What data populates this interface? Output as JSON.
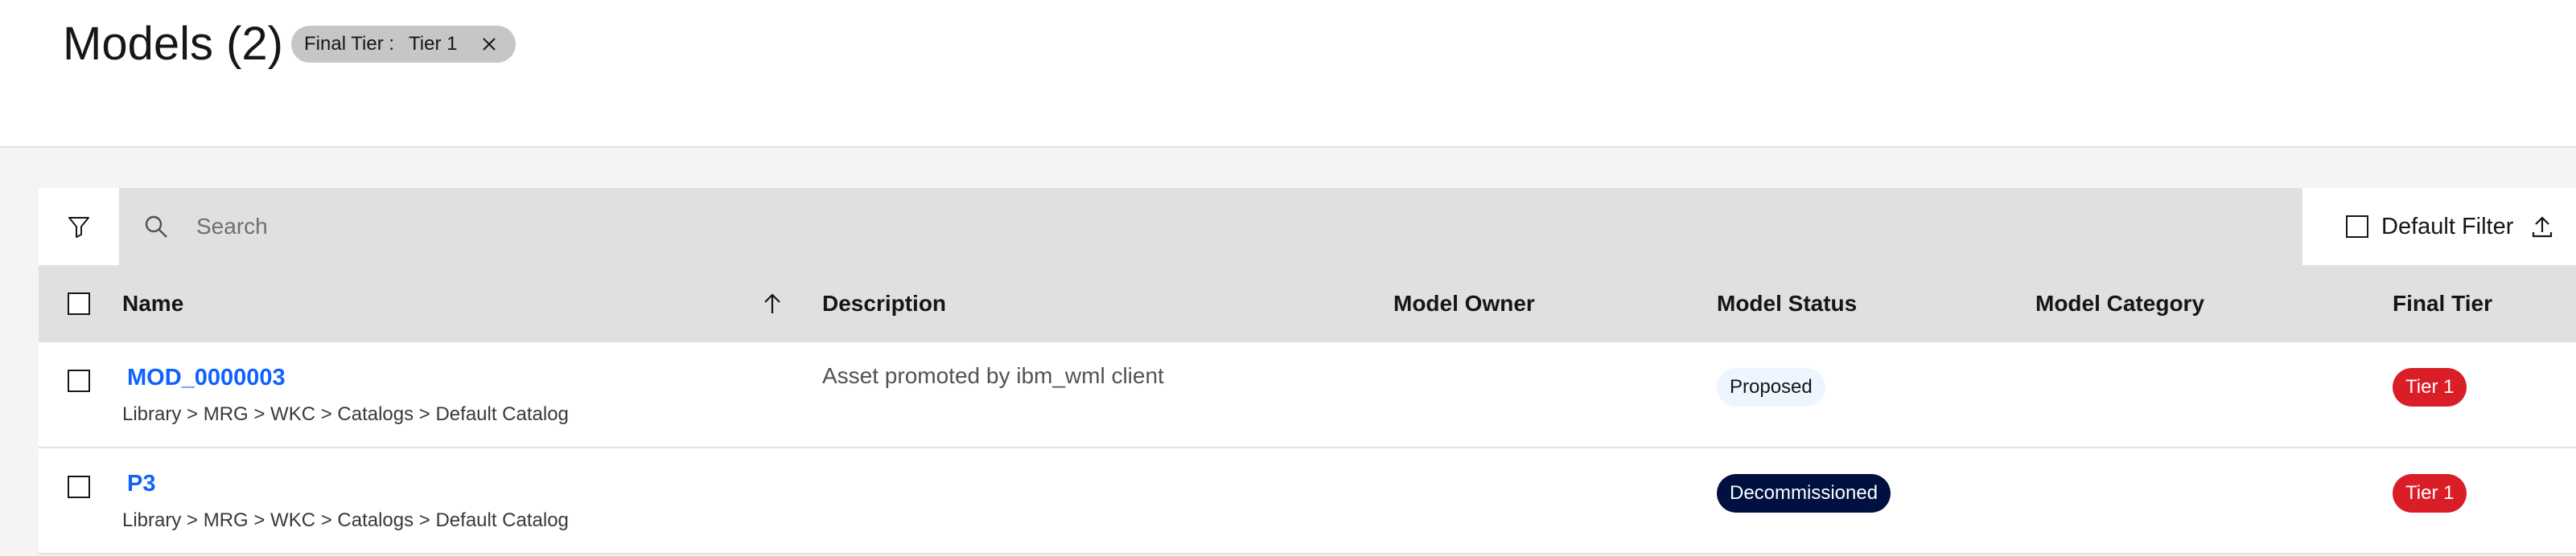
{
  "page": {
    "title": "Models (2)"
  },
  "active_filter": {
    "key": "Final Tier :",
    "value": "Tier 1"
  },
  "toolbar": {
    "search_placeholder": "Search",
    "default_filter_label": "Default Filter",
    "default_filter_checked": false
  },
  "table": {
    "columns": {
      "name": "Name",
      "description": "Description",
      "owner": "Model Owner",
      "status": "Model Status",
      "category": "Model Category",
      "tier": "Final Tier"
    },
    "sort": {
      "column": "Name",
      "direction": "ascending"
    },
    "rows": [
      {
        "name": "MOD_0000003",
        "path": "Library > MRG > WKC > Catalogs > Default Catalog",
        "description": "Asset promoted by ibm_wml client",
        "owner": "",
        "status": "Proposed",
        "category": "",
        "tier": "Tier 1"
      },
      {
        "name": "P3",
        "path": "Library > MRG > WKC > Catalogs > Default Catalog",
        "description": "",
        "owner": "",
        "status": "Decommissioned",
        "category": "",
        "tier": "Tier 1"
      }
    ]
  },
  "colors": {
    "link": "#0f62fe",
    "tier_badge": "#da1e28",
    "proposed_badge": "#edf5ff",
    "decommissioned_badge": "#001141"
  },
  "icons": {
    "filter": "filter-icon",
    "search": "search-icon",
    "close": "close-icon",
    "sort": "arrow-up-icon",
    "upload": "upload-icon"
  }
}
